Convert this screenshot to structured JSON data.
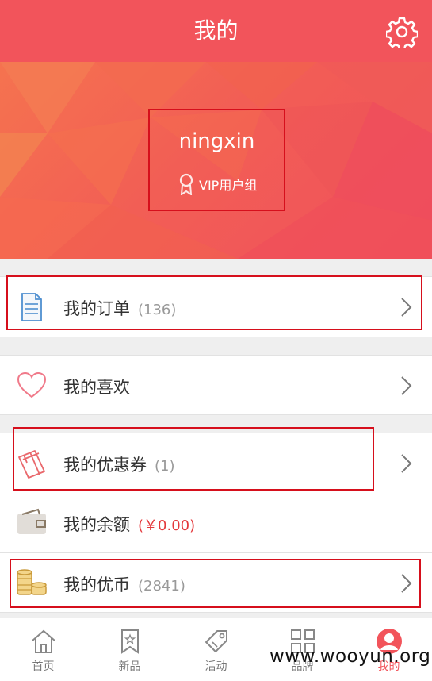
{
  "header": {
    "title": "我的",
    "settings_icon": "gear-icon"
  },
  "profile": {
    "username": "ningxin",
    "group": "VIP用户组"
  },
  "menu": {
    "orders": {
      "label": "我的订单",
      "count": "(136)"
    },
    "likes": {
      "label": "我的喜欢"
    },
    "coupons": {
      "label": "我的优惠券",
      "count": "(1)"
    },
    "balance": {
      "label": "我的余额",
      "amount": "(￥0.00)"
    },
    "coins": {
      "label": "我的优币",
      "count": "(2841)"
    }
  },
  "tabs": [
    {
      "label": "首页",
      "icon": "home-icon"
    },
    {
      "label": "新品",
      "icon": "bookmark-icon"
    },
    {
      "label": "活动",
      "icon": "tag-icon"
    },
    {
      "label": "品牌",
      "icon": "grid-icon"
    },
    {
      "label": "我的",
      "icon": "profile-icon",
      "active": true
    }
  ],
  "watermark": "www.wooyun.org",
  "colors": {
    "brand": "#f2545b",
    "highlight_box": "#d60f1c"
  }
}
